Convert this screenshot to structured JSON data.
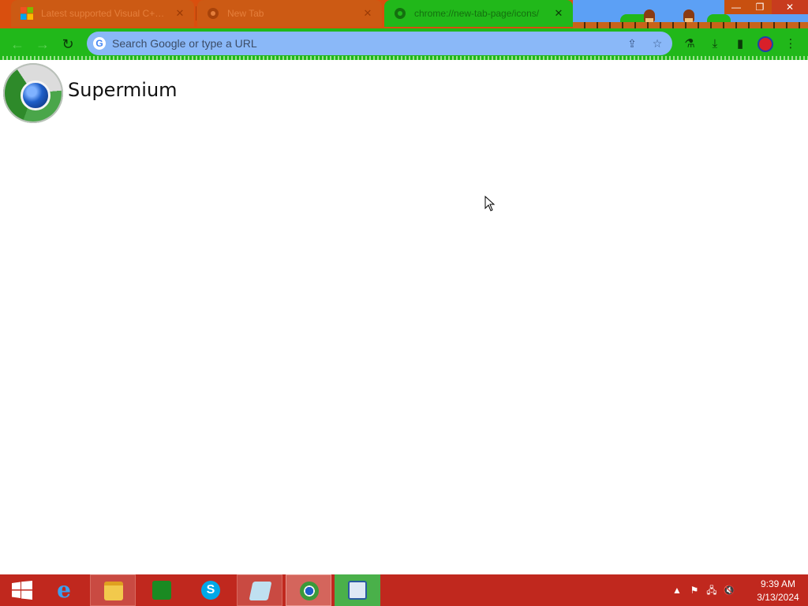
{
  "browser": {
    "tabs": [
      {
        "title": "Latest supported Visual C++ R",
        "active": false,
        "favicon": "microsoft-logo-icon"
      },
      {
        "title": "New Tab",
        "active": false,
        "favicon": "chrome-icon"
      },
      {
        "title": "chrome://new-tab-page/icons/",
        "active": true,
        "favicon": "chrome-icon"
      }
    ],
    "close_glyph": "✕",
    "new_tab_glyph": "+",
    "window_controls": {
      "minimize": "—",
      "restore": "❐",
      "close": "✕"
    },
    "omnibox": {
      "placeholder": "Search Google or type a URL",
      "value": ""
    },
    "colors": {
      "frame": "#d94f0e",
      "toolbar": "#21b81a",
      "omnibox": "#8ab8f8"
    }
  },
  "page": {
    "brand_name": "Supermium"
  },
  "taskbar": {
    "apps": [
      "start-menu",
      "internet-explorer",
      "file-explorer",
      "windows-store",
      "skype",
      "notepad",
      "supermium",
      "remote-desktop-connection"
    ],
    "tray": {
      "show_hidden": "▲",
      "time": "9:39 AM",
      "date": "3/13/2024"
    }
  }
}
